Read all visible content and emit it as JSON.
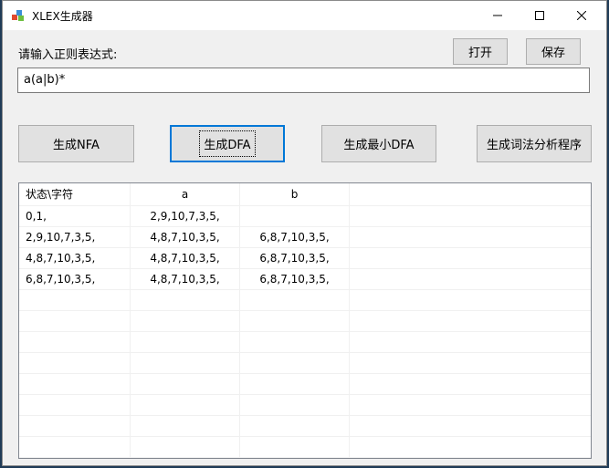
{
  "window": {
    "title": "XLEX生成器"
  },
  "form": {
    "regex_label": "请输入正则表达式:",
    "regex_value": "a(a|b)*",
    "open_label": "打开",
    "save_label": "保存"
  },
  "actions": {
    "nfa_label": "生成NFA",
    "dfa_label": "生成DFA",
    "min_dfa_label": "生成最小DFA",
    "lexer_label": "生成词法分析程序"
  },
  "table": {
    "headers": [
      "状态\\字符",
      "a",
      "b",
      ""
    ],
    "rows": [
      [
        "0,1,",
        "2,9,10,7,3,5,",
        "",
        ""
      ],
      [
        "2,9,10,7,3,5,",
        "4,8,7,10,3,5,",
        "6,8,7,10,3,5,",
        ""
      ],
      [
        "4,8,7,10,3,5,",
        "4,8,7,10,3,5,",
        "6,8,7,10,3,5,",
        ""
      ],
      [
        "6,8,7,10,3,5,",
        "4,8,7,10,3,5,",
        "6,8,7,10,3,5,",
        ""
      ]
    ]
  },
  "colors": {
    "accent": "#0078d7",
    "button_face": "#e1e1e1",
    "window_bg": "#f0f0f0"
  }
}
